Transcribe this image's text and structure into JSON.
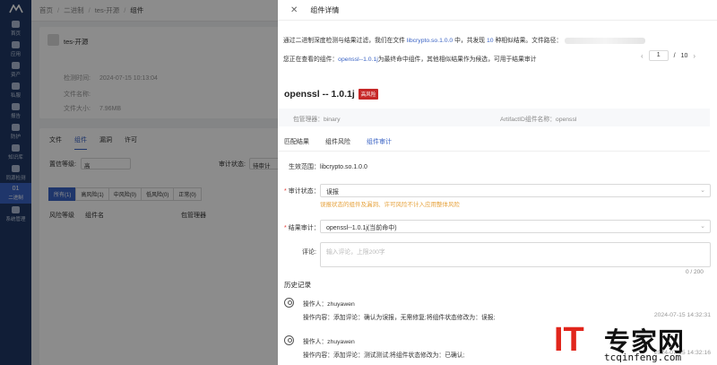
{
  "sidebar": {
    "items": [
      {
        "label": "首页"
      },
      {
        "label": "应用"
      },
      {
        "label": "资产"
      },
      {
        "label": "私服"
      },
      {
        "label": "报告"
      },
      {
        "label": "防护"
      },
      {
        "label": "知识库"
      },
      {
        "label": "同源检测"
      },
      {
        "label": "二进制",
        "badge": "01"
      },
      {
        "label": "系统管理"
      }
    ]
  },
  "breadcrumb": {
    "items": [
      "首页",
      "二进制",
      "tes-开源",
      "组件"
    ],
    "sep": "/"
  },
  "project": {
    "name": "tes-开源",
    "time_label": "检测时间:",
    "time_value": "2024-07-15 10:13:04",
    "file_label": "文件名称:",
    "size_label": "文件大小:",
    "size_value": "7.96MB"
  },
  "bg_tabs": [
    "文件",
    "组件",
    "漏洞",
    "许可"
  ],
  "bg_filter": {
    "label": "置信等级:",
    "value": "高",
    "audit_label": "审计状态:",
    "audit_value": "待审计"
  },
  "risk_segments": [
    "所有(1)",
    "高风险(1)",
    "中风险(0)",
    "低风险(0)",
    "正常(0)"
  ],
  "bg_table_headers": [
    "风险等级",
    "组件名",
    "包管理器"
  ],
  "drawer": {
    "title": "组件详情",
    "close": "✕",
    "alert_line1_a": "通过二进制深度检测与结果过滤，我们在文件",
    "alert_line1_file": "libcrypto.so.1.0.0",
    "alert_line1_b": "中，共发现",
    "alert_line1_count": "10",
    "alert_line1_c": "种相似结果。文件路径：",
    "alert_line2_a": "您正在查看的组件：",
    "alert_line2_comp": "openssl--1.0.1j",
    "alert_line2_b": "为最终命中组件，其他相似结果作为候选，可用于结果审计",
    "pager": {
      "current": "1",
      "sep": "/",
      "total": "10"
    },
    "component": "openssl -- 1.0.1j",
    "risk_tag": "高风险",
    "pkg_mgr": "包管理器：binary",
    "artifact": "ArtifactID组件名称：openssl",
    "tabs": [
      "匹配结果",
      "组件风险",
      "组件审计"
    ],
    "scope_label": "生效范围：",
    "scope_value": "libcrypto.so.1.0.0",
    "audit_status_label": "审计状态：",
    "audit_status_value": "误报",
    "warning": "误报状态的组件及漏洞、许可风险不计入应用整体风险",
    "result_label": "结果审计：",
    "result_value": "openssl--1.0.1j(当前命中)",
    "comment_label": "评论:",
    "comment_placeholder": "输入评论，上限200字",
    "count": "0 / 200",
    "history_title": "历史记录",
    "history": [
      {
        "operator": "操作人：zhuyawen",
        "content": "操作内容：添加评论：确认为误报，无需修复;将组件状态修改为：误报;",
        "time": "2024-07-15 14:32:31"
      },
      {
        "operator": "操作人：zhuyawen",
        "content": "操作内容：添加评论：测试测试;将组件状态修改为：已确认;",
        "time": "2024-07-15 14:32:16"
      }
    ]
  },
  "watermark": {
    "it": "IT",
    "zh": "专家网",
    "url": "tcqinfeng.com"
  },
  "colors": {
    "primary": "#3a63c4",
    "sidebar": "#1f3864",
    "danger": "#c62828",
    "warning": "#e6a23c"
  }
}
